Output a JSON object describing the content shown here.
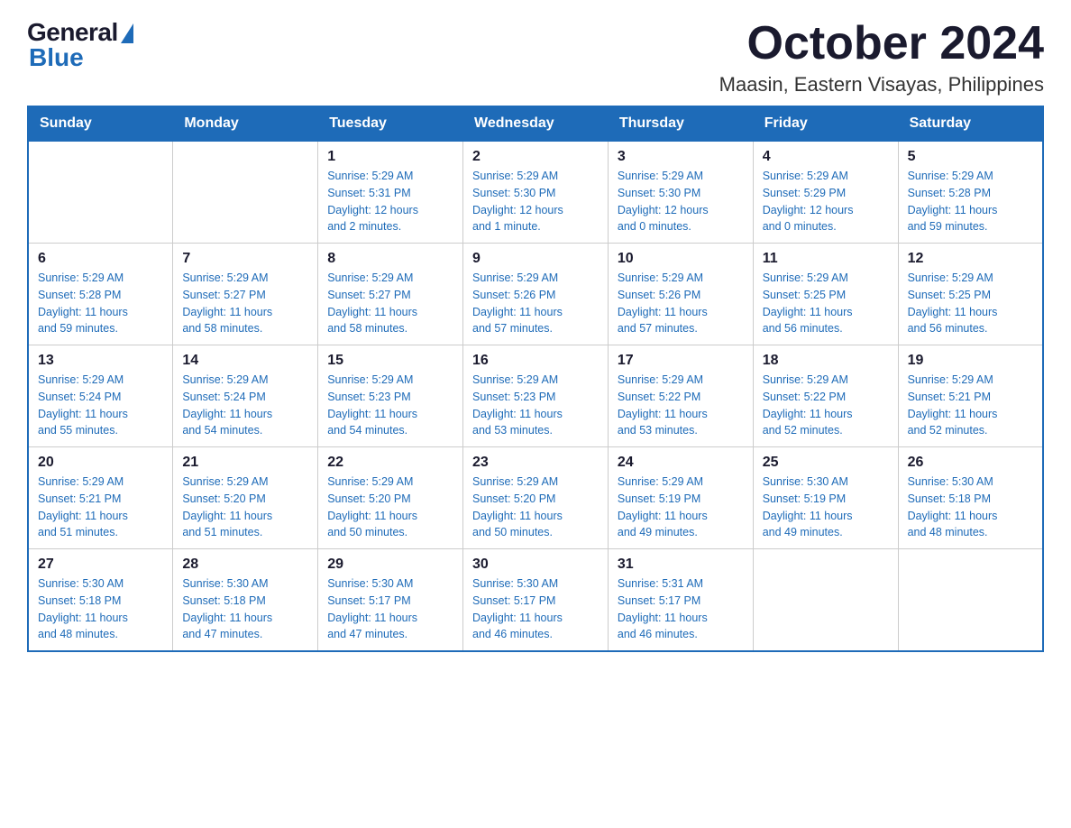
{
  "logo": {
    "general": "General",
    "blue": "Blue"
  },
  "title": {
    "month": "October 2024",
    "location": "Maasin, Eastern Visayas, Philippines"
  },
  "headers": [
    "Sunday",
    "Monday",
    "Tuesday",
    "Wednesday",
    "Thursday",
    "Friday",
    "Saturday"
  ],
  "weeks": [
    [
      {
        "day": "",
        "info": ""
      },
      {
        "day": "",
        "info": ""
      },
      {
        "day": "1",
        "info": "Sunrise: 5:29 AM\nSunset: 5:31 PM\nDaylight: 12 hours\nand 2 minutes."
      },
      {
        "day": "2",
        "info": "Sunrise: 5:29 AM\nSunset: 5:30 PM\nDaylight: 12 hours\nand 1 minute."
      },
      {
        "day": "3",
        "info": "Sunrise: 5:29 AM\nSunset: 5:30 PM\nDaylight: 12 hours\nand 0 minutes."
      },
      {
        "day": "4",
        "info": "Sunrise: 5:29 AM\nSunset: 5:29 PM\nDaylight: 12 hours\nand 0 minutes."
      },
      {
        "day": "5",
        "info": "Sunrise: 5:29 AM\nSunset: 5:28 PM\nDaylight: 11 hours\nand 59 minutes."
      }
    ],
    [
      {
        "day": "6",
        "info": "Sunrise: 5:29 AM\nSunset: 5:28 PM\nDaylight: 11 hours\nand 59 minutes."
      },
      {
        "day": "7",
        "info": "Sunrise: 5:29 AM\nSunset: 5:27 PM\nDaylight: 11 hours\nand 58 minutes."
      },
      {
        "day": "8",
        "info": "Sunrise: 5:29 AM\nSunset: 5:27 PM\nDaylight: 11 hours\nand 58 minutes."
      },
      {
        "day": "9",
        "info": "Sunrise: 5:29 AM\nSunset: 5:26 PM\nDaylight: 11 hours\nand 57 minutes."
      },
      {
        "day": "10",
        "info": "Sunrise: 5:29 AM\nSunset: 5:26 PM\nDaylight: 11 hours\nand 57 minutes."
      },
      {
        "day": "11",
        "info": "Sunrise: 5:29 AM\nSunset: 5:25 PM\nDaylight: 11 hours\nand 56 minutes."
      },
      {
        "day": "12",
        "info": "Sunrise: 5:29 AM\nSunset: 5:25 PM\nDaylight: 11 hours\nand 56 minutes."
      }
    ],
    [
      {
        "day": "13",
        "info": "Sunrise: 5:29 AM\nSunset: 5:24 PM\nDaylight: 11 hours\nand 55 minutes."
      },
      {
        "day": "14",
        "info": "Sunrise: 5:29 AM\nSunset: 5:24 PM\nDaylight: 11 hours\nand 54 minutes."
      },
      {
        "day": "15",
        "info": "Sunrise: 5:29 AM\nSunset: 5:23 PM\nDaylight: 11 hours\nand 54 minutes."
      },
      {
        "day": "16",
        "info": "Sunrise: 5:29 AM\nSunset: 5:23 PM\nDaylight: 11 hours\nand 53 minutes."
      },
      {
        "day": "17",
        "info": "Sunrise: 5:29 AM\nSunset: 5:22 PM\nDaylight: 11 hours\nand 53 minutes."
      },
      {
        "day": "18",
        "info": "Sunrise: 5:29 AM\nSunset: 5:22 PM\nDaylight: 11 hours\nand 52 minutes."
      },
      {
        "day": "19",
        "info": "Sunrise: 5:29 AM\nSunset: 5:21 PM\nDaylight: 11 hours\nand 52 minutes."
      }
    ],
    [
      {
        "day": "20",
        "info": "Sunrise: 5:29 AM\nSunset: 5:21 PM\nDaylight: 11 hours\nand 51 minutes."
      },
      {
        "day": "21",
        "info": "Sunrise: 5:29 AM\nSunset: 5:20 PM\nDaylight: 11 hours\nand 51 minutes."
      },
      {
        "day": "22",
        "info": "Sunrise: 5:29 AM\nSunset: 5:20 PM\nDaylight: 11 hours\nand 50 minutes."
      },
      {
        "day": "23",
        "info": "Sunrise: 5:29 AM\nSunset: 5:20 PM\nDaylight: 11 hours\nand 50 minutes."
      },
      {
        "day": "24",
        "info": "Sunrise: 5:29 AM\nSunset: 5:19 PM\nDaylight: 11 hours\nand 49 minutes."
      },
      {
        "day": "25",
        "info": "Sunrise: 5:30 AM\nSunset: 5:19 PM\nDaylight: 11 hours\nand 49 minutes."
      },
      {
        "day": "26",
        "info": "Sunrise: 5:30 AM\nSunset: 5:18 PM\nDaylight: 11 hours\nand 48 minutes."
      }
    ],
    [
      {
        "day": "27",
        "info": "Sunrise: 5:30 AM\nSunset: 5:18 PM\nDaylight: 11 hours\nand 48 minutes."
      },
      {
        "day": "28",
        "info": "Sunrise: 5:30 AM\nSunset: 5:18 PM\nDaylight: 11 hours\nand 47 minutes."
      },
      {
        "day": "29",
        "info": "Sunrise: 5:30 AM\nSunset: 5:17 PM\nDaylight: 11 hours\nand 47 minutes."
      },
      {
        "day": "30",
        "info": "Sunrise: 5:30 AM\nSunset: 5:17 PM\nDaylight: 11 hours\nand 46 minutes."
      },
      {
        "day": "31",
        "info": "Sunrise: 5:31 AM\nSunset: 5:17 PM\nDaylight: 11 hours\nand 46 minutes."
      },
      {
        "day": "",
        "info": ""
      },
      {
        "day": "",
        "info": ""
      }
    ]
  ]
}
